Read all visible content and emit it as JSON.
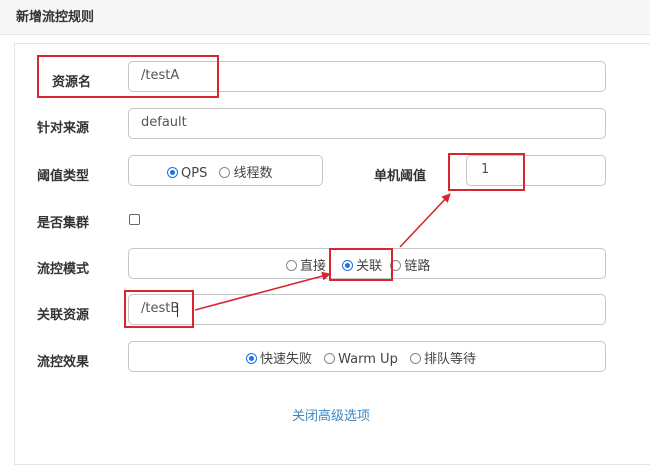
{
  "title": "新增流控规则",
  "form": {
    "resource_name_label": "资源名",
    "resource_name_value": "/testA",
    "limit_app_label": "针对来源",
    "limit_app_value": "default",
    "threshold_type_label": "阈值类型",
    "threshold_type_options": [
      "QPS",
      "线程数"
    ],
    "threshold_type_selected": "QPS",
    "single_threshold_label": "单机阈值",
    "single_threshold_value": "1",
    "cluster_label": "是否集群",
    "cluster_checked": false,
    "mode_label": "流控模式",
    "mode_options": [
      "直接",
      "关联",
      "链路"
    ],
    "mode_selected": "关联",
    "ref_resource_label": "关联资源",
    "ref_resource_value": "/testB",
    "effect_label": "流控效果",
    "effect_options": [
      "快速失败",
      "Warm Up",
      "排队等待"
    ],
    "effect_selected": "快速失败",
    "advanced_link": "关闭高级选项"
  },
  "colors": {
    "annotation": "#d9252f",
    "radio_selected": "#1a73e8",
    "link": "#3b86c4"
  }
}
